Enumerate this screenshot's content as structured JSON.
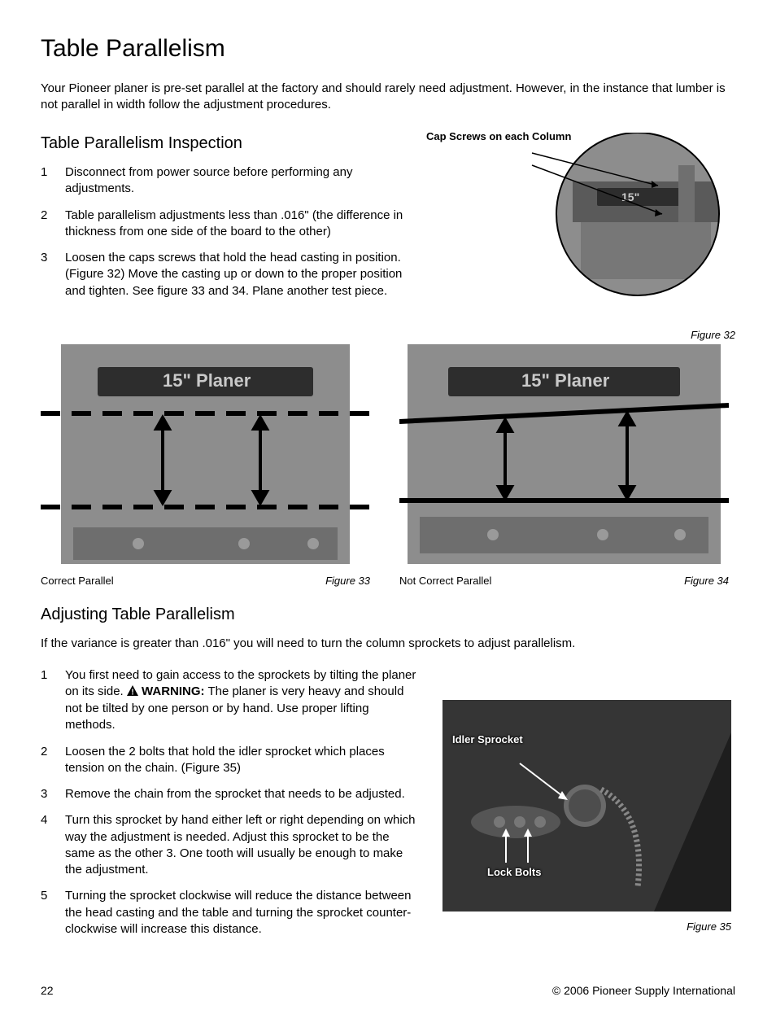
{
  "title": "Table Parallelism",
  "intro": "Your Pioneer planer is pre-set parallel at the factory and should rarely need adjustment. However, in the instance that lumber is not parallel in width follow the adjustment procedures.",
  "inspection": {
    "heading": "Table Parallelism Inspection",
    "steps": [
      "Disconnect from power source before performing any adjustments.",
      "Table parallelism adjustments less than .016\" (the difference in thickness from one side of the board to the other)",
      "Loosen the caps screws that hold the head casting in position. (Figure 32)  Move the casting up or down to the proper position and tighten. See figure 33 and 34. Plane another test piece."
    ]
  },
  "fig32": {
    "annot": "Cap Screws on each Column",
    "caption": "Figure 32"
  },
  "fig33": {
    "label": "Correct Parallel",
    "caption": "Figure 33"
  },
  "fig34": {
    "label": "Not Correct Parallel",
    "caption": "Figure 34"
  },
  "adjusting": {
    "heading": "Adjusting Table Parallelism",
    "intro": "If the variance is greater than .016\" you will need to turn the column sprockets to adjust parallelism.",
    "steps_before_warning": "You first need to gain access to the sprockets by tilting the planer on its side. ",
    "warning_label": "WARNING:",
    "steps_after_warning": " The planer is very heavy and should not be tilted by one person or by hand. Use proper lifting methods.",
    "steps_rest": [
      "Loosen the 2 bolts that hold the idler sprocket which places tension on the chain. (Figure 35)",
      "Remove the chain from the sprocket that needs to be adjusted.",
      "Turn this sprocket by hand either left or right depending on which way the adjustment is needed. Adjust this sprocket to be the same as the other 3. One tooth will usually be enough to make the adjustment.",
      "Turning the sprocket clockwise will reduce the distance between the head casting and the table and turning the sprocket counter-clockwise will increase this distance."
    ]
  },
  "fig35": {
    "annot1": "Idler Sprocket",
    "annot2": "Lock Bolts",
    "caption": "Figure 35"
  },
  "planer_label_text": "15\" Planer",
  "footer": {
    "page": "22",
    "copyright": "© 2006 Pioneer Supply International"
  }
}
